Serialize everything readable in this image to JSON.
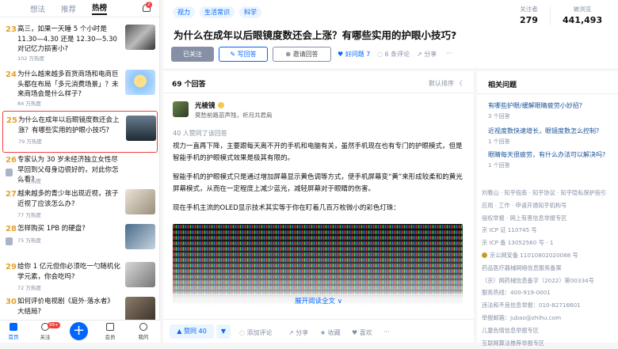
{
  "left": {
    "tabs": [
      "想法",
      "推荐",
      "热榜"
    ],
    "active_tab": "热榜",
    "notification_count": "2",
    "hot_list": [
      {
        "rank": "23",
        "title": "高三，如果一天睡 5 个小时是 11.30—4.30 还是 12.30—5.30 对记忆力损害小?",
        "heat": "102 万热度"
      },
      {
        "rank": "24",
        "title": "为什么越来越多百货商场和电商巨头都在布局「多元消费场景」？未来商场会是什么样子?",
        "heat": "84 万热度"
      },
      {
        "rank": "25",
        "title": "为什么在成年以后眼镜度数还会上涨？有哪些实用的护眼小技巧?",
        "heat": "79 万热度"
      },
      {
        "rank": "26",
        "title": "专家认为 30 岁未经济独立女性尽早回到父母身边很好的，对此你怎么看?",
        "heat": "79 万热度"
      },
      {
        "rank": "27",
        "title": "越来越多的青少年出现近视，孩子近视了应该怎么办?",
        "heat": "77 万热度"
      },
      {
        "rank": "28",
        "title": "怎样购买 1PB 的硬盘?",
        "heat": "75 万热度"
      },
      {
        "rank": "29",
        "title": "给你 1 亿元但你必须吃一勺随机化学元素，你会吃吗?",
        "heat": "72 万热度"
      },
      {
        "rank": "30",
        "title": "如何评价电视剧《庭外·落水者》大结局?",
        "heat": "70 万热度"
      }
    ],
    "bottom_nav": [
      "首页",
      "关注",
      "会员",
      "我的"
    ],
    "follow_badge": "99+"
  },
  "question": {
    "topics": [
      "视力",
      "生活常识",
      "科学"
    ],
    "title": "为什么在成年以后眼镜度数还会上涨？有哪些实用的护眼小技巧?",
    "followers_label": "关注者",
    "followers": "279",
    "views_label": "被浏览",
    "views": "441,493",
    "followed_button": "已关注",
    "write_answer": "写回答",
    "invite": "邀请回答",
    "good_question": "好问题 7",
    "comments": "6 条评论",
    "share": "分享",
    "more": "···"
  },
  "answers": {
    "count": "69 个回答",
    "sort": "默认排序 〈",
    "author": "光棱镜",
    "bio": "莫愁前路苗声残，祈月共君肩",
    "likes": "40 人赞同了该回答",
    "paragraphs": [
      "视力一直再下降，主要跟每天离不开的手机和电脑有关，虽然手机现在也有专门的护眼模式，但是智能手机的护眼模式效果是极其有限的。",
      "智能手机的护眼模式只是通过增加屏幕显示黄色调等方式，使手机屏幕变“黄”来形成较柔和的黄光屏幕模式，从而在一定程度上减少蓝光，减轻屏幕对于眼睛的伤害。",
      "现在手机主流的OLED显示技术其实等于你在盯着几百万枚微小的彩色灯珠："
    ],
    "expand": "展开阅读全文 ∨",
    "vote": "▲ 赞同 40",
    "downvote": "▼",
    "actions": [
      "添加评论",
      "分享",
      "收藏",
      "喜欢",
      "···"
    ]
  },
  "related": {
    "title": "相关问题",
    "items": [
      {
        "q": "有哪些护眼/缓解眼睛疲劳小妙招?",
        "c": "3 个回答"
      },
      {
        "q": "近视度数快速增长，眼镜度数怎么控制?",
        "c": "1 个回答"
      },
      {
        "q": "眼睛每天很疲劳，有什么办法可以解决吗?",
        "c": "1 个回答"
      }
    ]
  },
  "footer": [
    "刘看山 · 知乎指南 · 知乎协议 · 知乎隐私保护指引",
    "应用 · 工作 · 申请开通知乎机构号",
    "侵权举报 · 网上有害信息举报专区",
    "京 ICP 证 110745 号",
    "京 ICP 备 13052560 号 - 1",
    "京公网安备 11010802020088 号",
    "药品医疗器械网络信息服务备案",
    "（京）网药械信息备字（2022）第00334号",
    "服务热线：400-919-0001",
    "违法和不良信息举报：010-82716601",
    "举报邮箱：jubao@zhihu.com",
    "儿童色情信息举报专区",
    "互联网算法推荐举报专区"
  ]
}
